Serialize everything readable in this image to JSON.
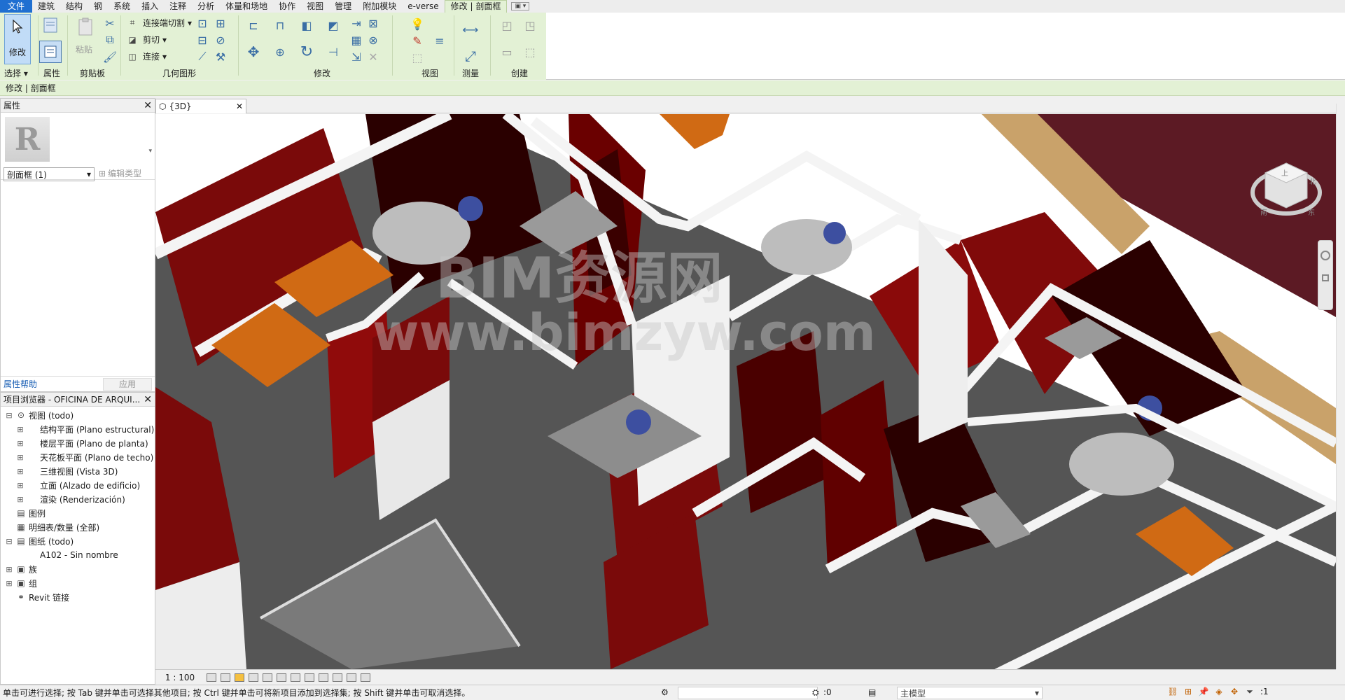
{
  "tabs": [
    "文件",
    "建筑",
    "结构",
    "钢",
    "系统",
    "插入",
    "注释",
    "分析",
    "体量和场地",
    "协作",
    "视图",
    "管理",
    "附加模块",
    "e-verse",
    "修改 | 剖面框"
  ],
  "tab_dropdown": "▣ ▾",
  "ribbon": {
    "select": {
      "button": "修改",
      "group": "选择 ▾"
    },
    "properties": {
      "group": "属性"
    },
    "clipboard": {
      "paste": "粘贴",
      "group": "剪贴板"
    },
    "geometry": {
      "cope": "连接端切割",
      "cut": "剪切",
      "join": "连接",
      "group": "几何图形"
    },
    "modify": {
      "group": "修改"
    },
    "view": {
      "group": "视图"
    },
    "measure": {
      "group": "测量"
    },
    "create": {
      "group": "创建"
    }
  },
  "context_bar": "修改 | 剖面框",
  "properties": {
    "title": "属性",
    "close": "✕",
    "logo": "R",
    "type_arrow": "▾",
    "selector": "剖面框 (1)",
    "selector_arrow": "▾",
    "edit_type": "编辑类型",
    "help": "属性帮助",
    "apply": "应用"
  },
  "browser": {
    "title": "项目浏览器 - OFICINA DE ARQUI...",
    "close": "✕",
    "nodes": [
      {
        "label": "视图 (todo)",
        "level": 0,
        "exp": "⊟"
      },
      {
        "label": "结构平面 (Plano estructural)",
        "level": 1,
        "exp": "⊞"
      },
      {
        "label": "楼层平面 (Plano de planta)",
        "level": 1,
        "exp": "⊞"
      },
      {
        "label": "天花板平面 (Plano de techo)",
        "level": 1,
        "exp": "⊞"
      },
      {
        "label": "三维视图 (Vista 3D)",
        "level": 1,
        "exp": "⊞"
      },
      {
        "label": "立面 (Alzado de edificio)",
        "level": 1,
        "exp": "⊞"
      },
      {
        "label": "渲染 (Renderización)",
        "level": 1,
        "exp": "⊞"
      },
      {
        "label": "图例",
        "level": 0,
        "exp": ""
      },
      {
        "label": "明细表/数量 (全部)",
        "level": 0,
        "exp": ""
      },
      {
        "label": "图纸 (todo)",
        "level": 0,
        "exp": "⊟"
      },
      {
        "label": "A102 - Sin nombre",
        "level": 1,
        "exp": ""
      },
      {
        "label": "族",
        "level": 0,
        "exp": "⊞"
      },
      {
        "label": "组",
        "level": 0,
        "exp": "⊞"
      },
      {
        "label": "Revit 链接",
        "level": 0,
        "exp": ""
      }
    ]
  },
  "view_tab": {
    "label": "{3D}",
    "close": "✕"
  },
  "watermark": {
    "line1": "BIM资源网",
    "line2": "www.bimzyw.com"
  },
  "viewcube": {
    "face": "上",
    "south": "南",
    "east": "东",
    "north": "北"
  },
  "view_control": {
    "scale": "1 : 100"
  },
  "status": {
    "message": "单击可进行选择; 按 Tab 键并单击可选择其他项目; 按 Ctrl 键并单击可将新项目添加到选择集; 按 Shift 键并单击可取消选择。",
    "zero": ":0",
    "model": "主模型",
    "filter_count": ":1"
  },
  "colors": {
    "accent": "#1f6fd1",
    "ribbon": "#e3f1d5",
    "wall_red": "#7a0a0a",
    "floor": "#555555"
  }
}
